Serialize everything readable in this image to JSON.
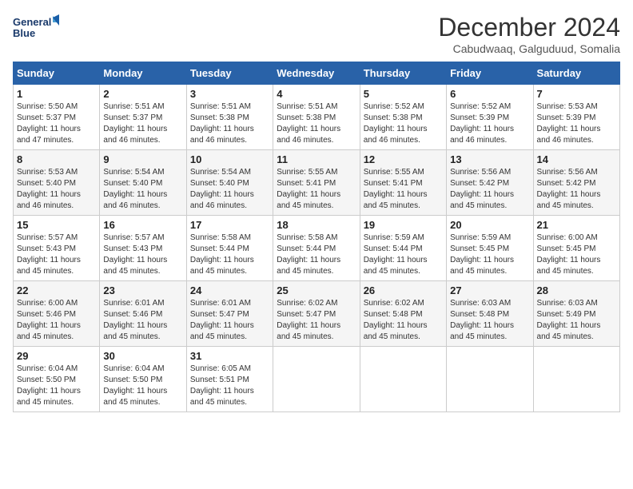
{
  "logo": {
    "line1": "General",
    "line2": "Blue"
  },
  "title": "December 2024",
  "subtitle": "Cabudwaaq, Galguduud, Somalia",
  "weekdays": [
    "Sunday",
    "Monday",
    "Tuesday",
    "Wednesday",
    "Thursday",
    "Friday",
    "Saturday"
  ],
  "weeks": [
    [
      {
        "day": "1",
        "sunrise": "5:50 AM",
        "sunset": "5:37 PM",
        "daylight": "11 hours and 47 minutes."
      },
      {
        "day": "2",
        "sunrise": "5:51 AM",
        "sunset": "5:37 PM",
        "daylight": "11 hours and 46 minutes."
      },
      {
        "day": "3",
        "sunrise": "5:51 AM",
        "sunset": "5:38 PM",
        "daylight": "11 hours and 46 minutes."
      },
      {
        "day": "4",
        "sunrise": "5:51 AM",
        "sunset": "5:38 PM",
        "daylight": "11 hours and 46 minutes."
      },
      {
        "day": "5",
        "sunrise": "5:52 AM",
        "sunset": "5:38 PM",
        "daylight": "11 hours and 46 minutes."
      },
      {
        "day": "6",
        "sunrise": "5:52 AM",
        "sunset": "5:39 PM",
        "daylight": "11 hours and 46 minutes."
      },
      {
        "day": "7",
        "sunrise": "5:53 AM",
        "sunset": "5:39 PM",
        "daylight": "11 hours and 46 minutes."
      }
    ],
    [
      {
        "day": "8",
        "sunrise": "5:53 AM",
        "sunset": "5:40 PM",
        "daylight": "11 hours and 46 minutes."
      },
      {
        "day": "9",
        "sunrise": "5:54 AM",
        "sunset": "5:40 PM",
        "daylight": "11 hours and 46 minutes."
      },
      {
        "day": "10",
        "sunrise": "5:54 AM",
        "sunset": "5:40 PM",
        "daylight": "11 hours and 46 minutes."
      },
      {
        "day": "11",
        "sunrise": "5:55 AM",
        "sunset": "5:41 PM",
        "daylight": "11 hours and 45 minutes."
      },
      {
        "day": "12",
        "sunrise": "5:55 AM",
        "sunset": "5:41 PM",
        "daylight": "11 hours and 45 minutes."
      },
      {
        "day": "13",
        "sunrise": "5:56 AM",
        "sunset": "5:42 PM",
        "daylight": "11 hours and 45 minutes."
      },
      {
        "day": "14",
        "sunrise": "5:56 AM",
        "sunset": "5:42 PM",
        "daylight": "11 hours and 45 minutes."
      }
    ],
    [
      {
        "day": "15",
        "sunrise": "5:57 AM",
        "sunset": "5:43 PM",
        "daylight": "11 hours and 45 minutes."
      },
      {
        "day": "16",
        "sunrise": "5:57 AM",
        "sunset": "5:43 PM",
        "daylight": "11 hours and 45 minutes."
      },
      {
        "day": "17",
        "sunrise": "5:58 AM",
        "sunset": "5:44 PM",
        "daylight": "11 hours and 45 minutes."
      },
      {
        "day": "18",
        "sunrise": "5:58 AM",
        "sunset": "5:44 PM",
        "daylight": "11 hours and 45 minutes."
      },
      {
        "day": "19",
        "sunrise": "5:59 AM",
        "sunset": "5:44 PM",
        "daylight": "11 hours and 45 minutes."
      },
      {
        "day": "20",
        "sunrise": "5:59 AM",
        "sunset": "5:45 PM",
        "daylight": "11 hours and 45 minutes."
      },
      {
        "day": "21",
        "sunrise": "6:00 AM",
        "sunset": "5:45 PM",
        "daylight": "11 hours and 45 minutes."
      }
    ],
    [
      {
        "day": "22",
        "sunrise": "6:00 AM",
        "sunset": "5:46 PM",
        "daylight": "11 hours and 45 minutes."
      },
      {
        "day": "23",
        "sunrise": "6:01 AM",
        "sunset": "5:46 PM",
        "daylight": "11 hours and 45 minutes."
      },
      {
        "day": "24",
        "sunrise": "6:01 AM",
        "sunset": "5:47 PM",
        "daylight": "11 hours and 45 minutes."
      },
      {
        "day": "25",
        "sunrise": "6:02 AM",
        "sunset": "5:47 PM",
        "daylight": "11 hours and 45 minutes."
      },
      {
        "day": "26",
        "sunrise": "6:02 AM",
        "sunset": "5:48 PM",
        "daylight": "11 hours and 45 minutes."
      },
      {
        "day": "27",
        "sunrise": "6:03 AM",
        "sunset": "5:48 PM",
        "daylight": "11 hours and 45 minutes."
      },
      {
        "day": "28",
        "sunrise": "6:03 AM",
        "sunset": "5:49 PM",
        "daylight": "11 hours and 45 minutes."
      }
    ],
    [
      {
        "day": "29",
        "sunrise": "6:04 AM",
        "sunset": "5:50 PM",
        "daylight": "11 hours and 45 minutes."
      },
      {
        "day": "30",
        "sunrise": "6:04 AM",
        "sunset": "5:50 PM",
        "daylight": "11 hours and 45 minutes."
      },
      {
        "day": "31",
        "sunrise": "6:05 AM",
        "sunset": "5:51 PM",
        "daylight": "11 hours and 45 minutes."
      },
      null,
      null,
      null,
      null
    ]
  ],
  "labels": {
    "sunrise": "Sunrise:",
    "sunset": "Sunset:",
    "daylight": "Daylight:"
  }
}
